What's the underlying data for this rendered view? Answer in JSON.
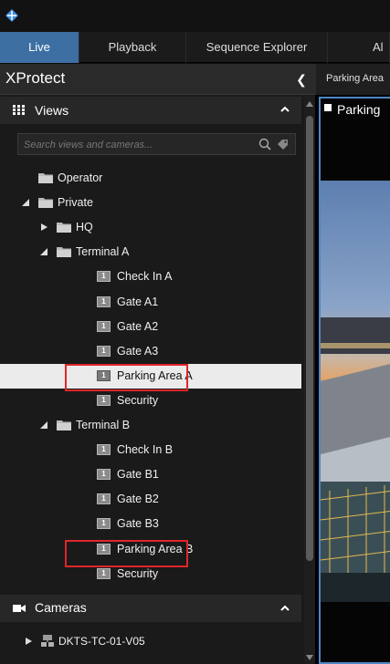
{
  "app": {
    "tabs": [
      {
        "label": "Live",
        "active": true
      },
      {
        "label": "Playback",
        "active": false
      },
      {
        "label": "Sequence Explorer",
        "active": false
      },
      {
        "label": "Al",
        "active": false
      }
    ]
  },
  "sidebar": {
    "title": "XProtect",
    "views": {
      "header": "Views",
      "search_placeholder": "Search views and cameras...",
      "tree": [
        {
          "label": "Operator",
          "kind": "folder"
        },
        {
          "label": "Private",
          "kind": "folder",
          "expanded": true
        },
        {
          "label": "HQ",
          "kind": "folder",
          "expanded": false
        },
        {
          "label": "Terminal A",
          "kind": "folder",
          "expanded": true
        },
        {
          "label": "Check In A",
          "kind": "view"
        },
        {
          "label": "Gate A1",
          "kind": "view"
        },
        {
          "label": "Gate A2",
          "kind": "view"
        },
        {
          "label": "Gate A3",
          "kind": "view"
        },
        {
          "label": "Parking Area A",
          "kind": "view",
          "selected": true,
          "highlighted": true
        },
        {
          "label": "Security",
          "kind": "view"
        },
        {
          "label": "Terminal B",
          "kind": "folder",
          "expanded": true
        },
        {
          "label": "Check In B",
          "kind": "view"
        },
        {
          "label": "Gate B1",
          "kind": "view"
        },
        {
          "label": "Gate B2",
          "kind": "view"
        },
        {
          "label": "Gate B3",
          "kind": "view"
        },
        {
          "label": "Parking Area B",
          "kind": "view",
          "highlighted": true
        },
        {
          "label": "Security",
          "kind": "view"
        }
      ],
      "view_icon_text": "1"
    },
    "cameras": {
      "header": "Cameras",
      "items": [
        {
          "label": "DKTS-TC-01-V05"
        }
      ]
    }
  },
  "right_pane": {
    "tab_label": "Parking Area",
    "view_title": "Parking"
  },
  "colors": {
    "active_tab": "#3d6fa3",
    "selection_bg": "#ebebeb",
    "highlight_border": "#e0262b",
    "view_border": "#4f86c4"
  },
  "icons": {
    "app": "xprotect-logo-icon",
    "views": "grid-icon",
    "cameras": "camera-icon",
    "search": "search-icon",
    "tag": "tag-icon",
    "collapse": "chevron-left-icon"
  }
}
